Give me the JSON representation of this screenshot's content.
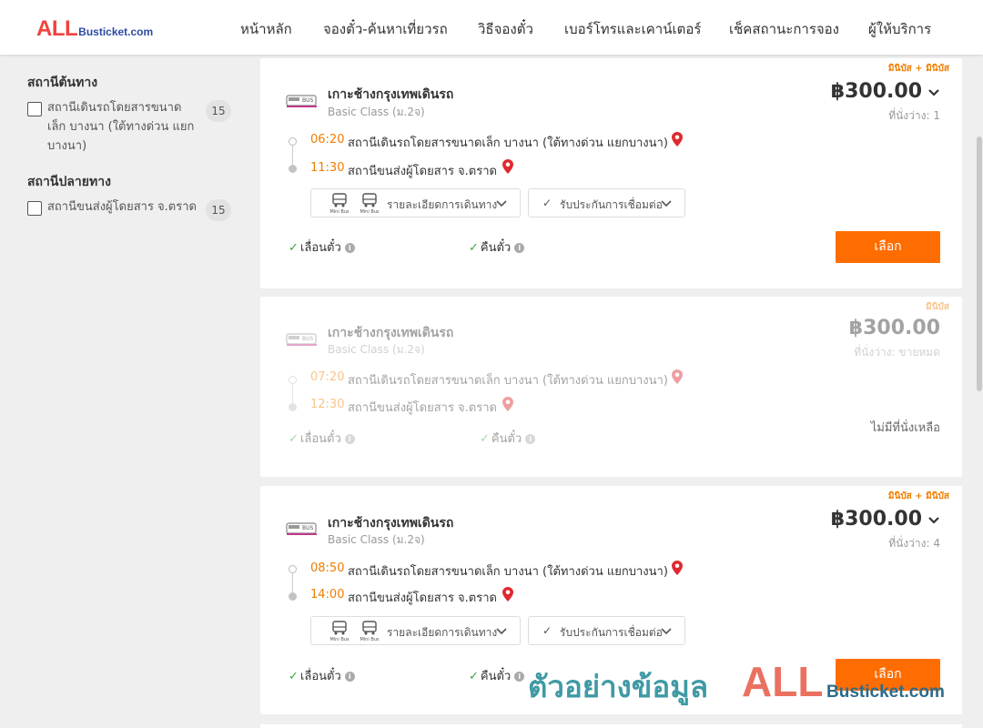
{
  "header": {
    "logo_all": "ALL",
    "logo_bus": "Busticket.com",
    "nav": [
      "หน้าหลัก",
      "จองตั๋ว-ค้นหาเที่ยวรถ",
      "วิธีจองตั๋ว",
      "เบอร์โทรและเคาน์เตอร์",
      "เช็คสถานะการจอง",
      "ผู้ให้บริการ"
    ]
  },
  "sidebar": {
    "origin_title": "สถานีต้นทาง",
    "origin_items": [
      {
        "label": "สถานีเดินรถโดยสารขนาดเล็ก บางนา (ใต้ทางด่วน แยกบางนา)",
        "count": "15"
      }
    ],
    "dest_title": "สถานีปลายทาง",
    "dest_items": [
      {
        "label": "สถานีขนส่งผู้โดยสาร จ.ตราด",
        "count": "15"
      }
    ]
  },
  "trips": [
    {
      "tag": "มินิบัส + มินิบัส",
      "route": "เกาะช้างกรุงเทพเดินรถ",
      "class": "Basic Class (ม.2จ)",
      "price": "฿300.00",
      "seats": "ที่นั่งว่าง: 1",
      "dep_time": "06:20",
      "dep_stop": "สถานีเดินรถโดยสารขนาดเล็ก บางนา (ใต้ทางด่วน แยกบางนา)",
      "arr_time": "11:30",
      "arr_stop": "สถานีขนส่งผู้โดยสาร จ.ตราด",
      "detail_label": "รายละเอียดการเดินทาง",
      "insure_label": "รับประกันการเชื่อมต่อ",
      "bus_label": "Mini Bus",
      "change": "เลื่อนตั๋ว",
      "refund": "คืนตั๋ว",
      "select": "เลือก"
    },
    {
      "tag": "มินิบัส",
      "route": "เกาะช้างกรุงเทพเดินรถ",
      "class": "Basic Class (ม.2จ)",
      "price": "฿300.00",
      "seats": "ที่นั่งว่าง: ขายหมด",
      "dep_time": "07:20",
      "dep_stop": "สถานีเดินรถโดยสารขนาดเล็ก บางนา (ใต้ทางด่วน แยกบางนา)",
      "arr_time": "12:30",
      "arr_stop": "สถานีขนส่งผู้โดยสาร จ.ตราด",
      "change": "เลื่อนตั๋ว",
      "refund": "คืนตั๋ว",
      "sold_out": "ไม่มีที่นั่งเหลือ"
    },
    {
      "tag": "มินิบัส + มินิบัส",
      "route": "เกาะช้างกรุงเทพเดินรถ",
      "class": "Basic Class (ม.2จ)",
      "price": "฿300.00",
      "seats": "ที่นั่งว่าง: 4",
      "dep_time": "08:50",
      "dep_stop": "สถานีเดินรถโดยสารขนาดเล็ก บางนา (ใต้ทางด่วน แยกบางนา)",
      "arr_time": "14:00",
      "arr_stop": "สถานีขนส่งผู้โดยสาร จ.ตราด",
      "detail_label": "รายละเอียดการเดินทาง",
      "insure_label": "รับประกันการเชื่อมต่อ",
      "bus_label": "Mini Bus",
      "change": "เลื่อนตั๋ว",
      "refund": "คืนตั๋ว",
      "select": "เลือก"
    }
  ],
  "watermark": {
    "text": "ตัวอย่างข้อมูล",
    "all": "ALL",
    "bus": "Busticket.com"
  },
  "colors": {
    "accent": "#ff6d00",
    "time": "#f07d00",
    "check": "#3aa83e",
    "pin": "#e0282e"
  }
}
